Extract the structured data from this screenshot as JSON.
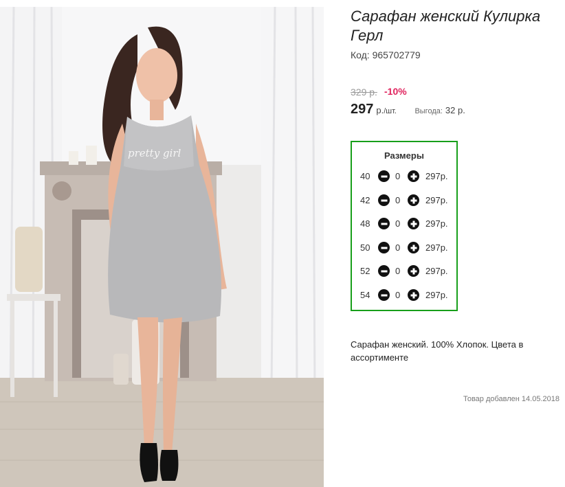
{
  "product": {
    "title": "Сарафан женский Кулирка Герл",
    "code": "Код: 965702779",
    "old_price": "329 р.",
    "discount": "-10%",
    "price": "297",
    "unit_prefix": "р.",
    "unit_suffix": "/шт.",
    "benefit_label": "Выгода:",
    "benefit_value": "32 р.",
    "description": "Сарафан женский. 100% Хлопок. Цвета в ассортименте",
    "added": "Товар добавлен 14.05.2018",
    "dress_print": "pretty girl"
  },
  "sizes": {
    "title": "Размеры",
    "rows": [
      {
        "size": "40",
        "qty": "0",
        "price": "297р."
      },
      {
        "size": "42",
        "qty": "0",
        "price": "297р."
      },
      {
        "size": "48",
        "qty": "0",
        "price": "297р."
      },
      {
        "size": "50",
        "qty": "0",
        "price": "297р."
      },
      {
        "size": "52",
        "qty": "0",
        "price": "297р."
      },
      {
        "size": "54",
        "qty": "0",
        "price": "297р."
      }
    ]
  },
  "icons": {
    "minus": "minus-circle-icon",
    "plus": "plus-circle-icon"
  },
  "colors": {
    "sizes_border": "#179f1a",
    "discount": "#e0245e",
    "cart_button": "#b7f042"
  }
}
